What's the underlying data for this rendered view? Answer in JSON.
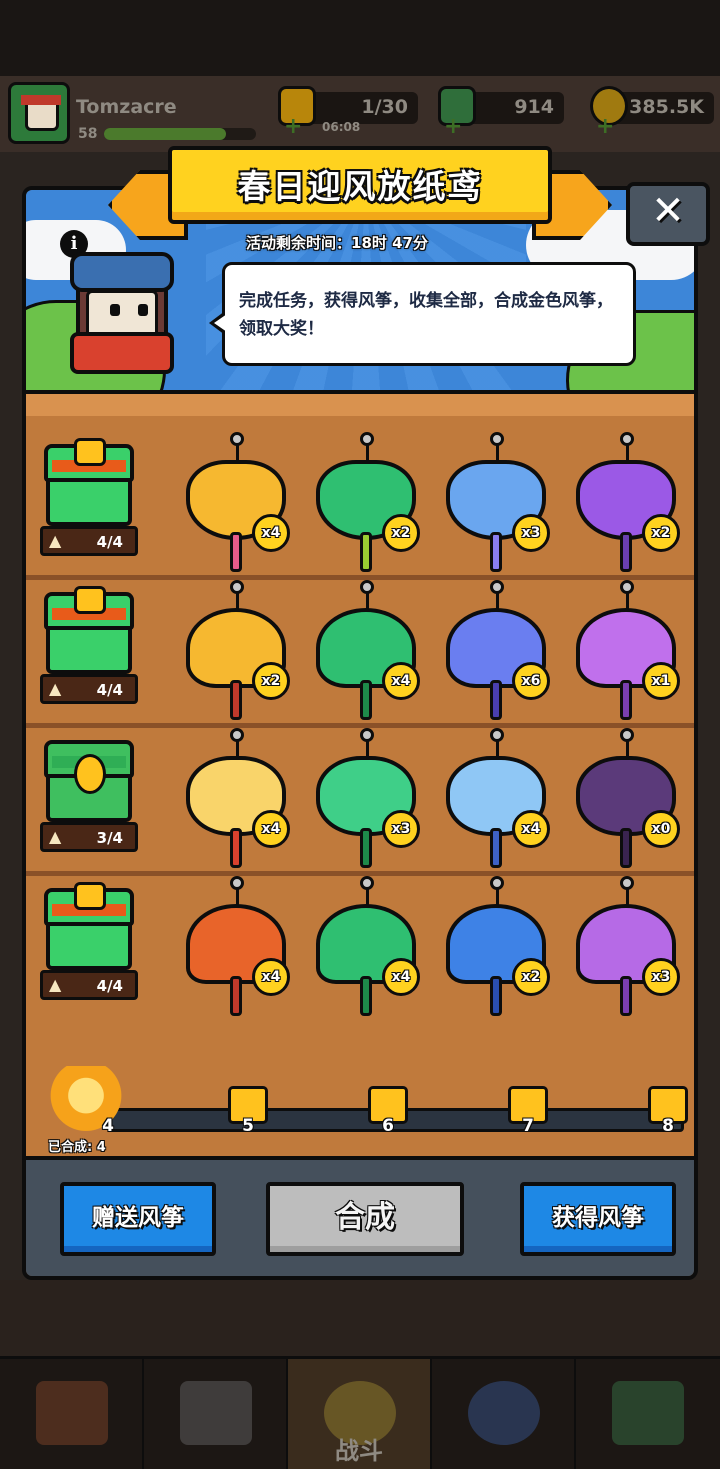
{
  "hud": {
    "username": "Tomzacre",
    "level": "58",
    "energy": "1/30",
    "energy_timer": "06:08",
    "gems": "914",
    "coins": "385.5K"
  },
  "event": {
    "title": "春日迎风放纸鸢",
    "timer": "活动剩余时间：18时 47分",
    "description": "完成任务，获得风筝，收集全部，合成金色风筝，领取大奖！",
    "info_icon": "i",
    "close_icon": "✕"
  },
  "rows": [
    {
      "progress": "4/4",
      "kites": [
        {
          "count": "x4",
          "color": "#f6b830"
        },
        {
          "count": "x2",
          "color": "#2fbf71"
        },
        {
          "count": "x3",
          "color": "#6aa6ef"
        },
        {
          "count": "x2",
          "color": "#9b59e6"
        }
      ]
    },
    {
      "progress": "4/4",
      "kites": [
        {
          "count": "x2",
          "color": "#f6b830"
        },
        {
          "count": "x4",
          "color": "#2fbf71"
        },
        {
          "count": "x6",
          "color": "#6a7ef0"
        },
        {
          "count": "x1",
          "color": "#c070ec"
        }
      ]
    },
    {
      "progress": "3/4",
      "kites": [
        {
          "count": "x4",
          "color": "#f9d46a"
        },
        {
          "count": "x3",
          "color": "#3fcf88"
        },
        {
          "count": "x4",
          "color": "#8fc7f5"
        },
        {
          "count": "x0",
          "color": "#5b3a7a"
        }
      ]
    },
    {
      "progress": "4/4",
      "kites": [
        {
          "count": "x4",
          "color": "#e8642a"
        },
        {
          "count": "x4",
          "color": "#2fbf71"
        },
        {
          "count": "x2",
          "color": "#3e82e6"
        },
        {
          "count": "x3",
          "color": "#b66ae6"
        }
      ]
    }
  ],
  "track": {
    "merged_label": "已合成: 4",
    "current": "4",
    "milestones": [
      "5",
      "6",
      "7",
      "8"
    ]
  },
  "buttons": {
    "gift": "赠送风筝",
    "merge": "合成",
    "obtain": "获得风筝"
  },
  "nav": {
    "battle": "战斗"
  },
  "colors": {
    "title_yellow": "#ffd21f",
    "button_blue": "#1e88e5",
    "chest_green": "#3fbf5f"
  }
}
